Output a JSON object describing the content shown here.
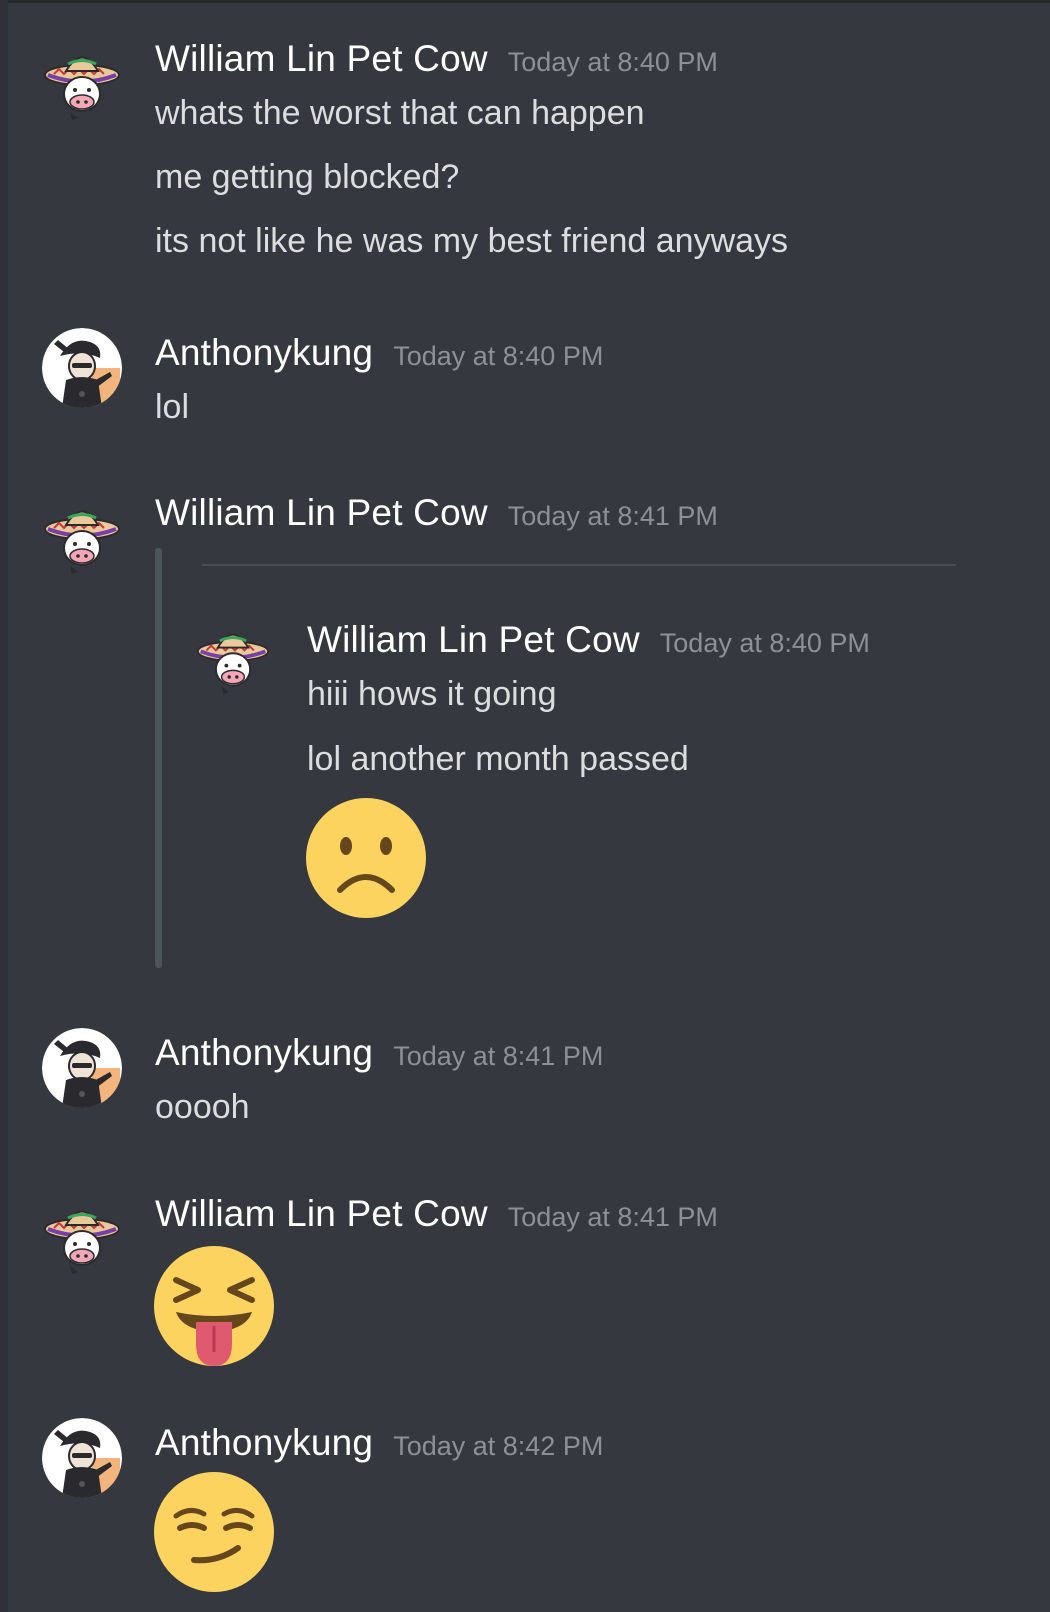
{
  "messages": [
    {
      "author": "William Lin Pet Cow",
      "avatar": "cow-sombrero-avatar",
      "timestamp": "Today at 8:40 PM",
      "lines": [
        "whats the worst that can happen",
        "me getting blocked?",
        "its not like he was my best friend anyways"
      ]
    },
    {
      "author": "Anthonykung",
      "avatar": "dabbing-character-avatar",
      "timestamp": "Today at 8:40 PM",
      "lines": [
        "lol"
      ]
    },
    {
      "author": "William Lin Pet Cow",
      "avatar": "cow-sombrero-avatar",
      "timestamp": "Today at 8:41 PM",
      "quoted": {
        "author": "William Lin Pet Cow",
        "avatar": "cow-sombrero-avatar",
        "timestamp": "Today at 8:40 PM",
        "lines": [
          "hiii hows it going",
          "lol another month passed"
        ],
        "emoji": "frowning-face-emoji"
      }
    },
    {
      "author": "Anthonykung",
      "avatar": "dabbing-character-avatar",
      "timestamp": "Today at 8:41 PM",
      "lines": [
        "ooooh"
      ]
    },
    {
      "author": "William Lin Pet Cow",
      "avatar": "cow-sombrero-avatar",
      "timestamp": "Today at 8:41 PM",
      "emoji": "squinting-tongue-face-emoji"
    },
    {
      "author": "Anthonykung",
      "avatar": "dabbing-character-avatar",
      "timestamp": "Today at 8:42 PM",
      "emoji": "smirking-face-emoji"
    }
  ],
  "colors": {
    "background": "#36383f",
    "username": "#ffffff",
    "message_text": "#dcddde",
    "timestamp": "#8d9096",
    "emoji_yellow": "#fcd35f"
  }
}
